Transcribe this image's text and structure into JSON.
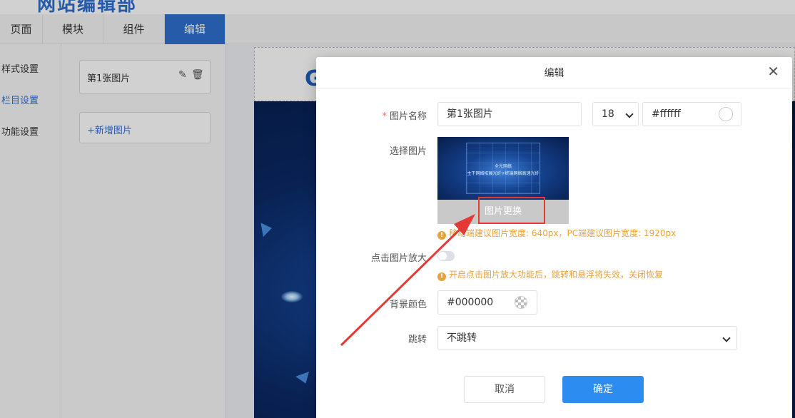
{
  "app": {
    "logo_text": "网站编辑部"
  },
  "tabs": [
    {
      "label": "页面"
    },
    {
      "label": "模块"
    },
    {
      "label": "组件"
    },
    {
      "label": "编辑",
      "active": true
    }
  ],
  "sidenav": {
    "items": [
      {
        "label": "样式设置"
      },
      {
        "label": "栏目设置",
        "active": true
      },
      {
        "label": "功能设置"
      }
    ]
  },
  "panel": {
    "image_card_label": "第1张图片",
    "edit_icon": "pencil-icon",
    "delete_icon": "trash-icon",
    "add_label": "+新增图片"
  },
  "dialog": {
    "title": "编辑",
    "close_icon": "close-icon",
    "fields": {
      "image_name": {
        "label": "图片名称",
        "required": true,
        "value": "第1张图片"
      },
      "font_size": {
        "value": "18"
      },
      "text_color": {
        "value": "#ffffff"
      },
      "select_image": {
        "label": "选择图片"
      },
      "replace_button": "图片更换",
      "size_tip": "移动端建议图片宽度: 640px，PC端建议图片宽度: 1920px",
      "zoom": {
        "label": "点击图片放大",
        "enabled": false
      },
      "zoom_tip": "开启点击图片放大功能后，跳转和悬浮将失效，关闭恢复",
      "bg_color": {
        "label": "背景颜色",
        "value": "#000000"
      },
      "jump": {
        "label": "跳转",
        "value": "不跳转"
      }
    },
    "thumb_text": {
      "line1": "全光网络",
      "line2": "主干网络拓展光纤+终端网络高速光纤"
    },
    "cancel_label": "取消",
    "confirm_label": "确定"
  },
  "colors": {
    "primary": "#2d8cf0",
    "brand": "#2f6fd0",
    "warning": "#e6a23c",
    "highlight": "#e53935"
  }
}
